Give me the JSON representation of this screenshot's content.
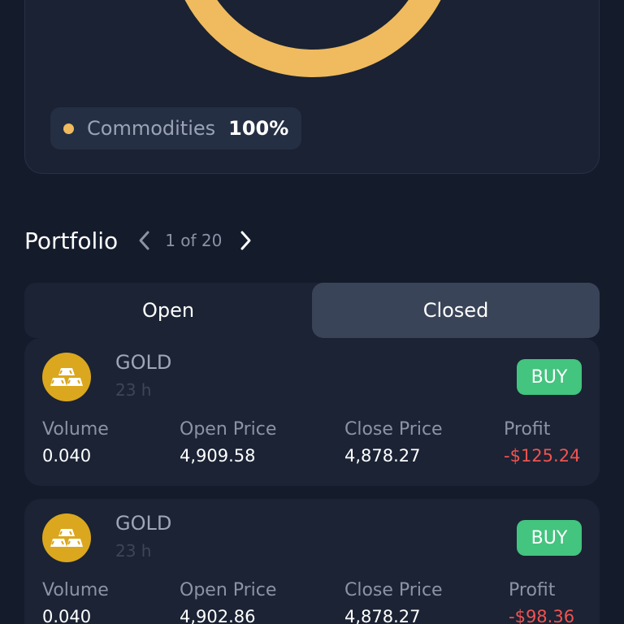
{
  "allocation": {
    "accent_color": "#efbb5e",
    "legend": [
      {
        "name": "Commodities",
        "percent": "100%",
        "color": "#efbb5e"
      }
    ]
  },
  "portfolio": {
    "title": "Portfolio",
    "pager": "1 of 20",
    "prev_icon": "chevron-left-icon",
    "next_icon": "chevron-right-icon"
  },
  "tabs": [
    {
      "label": "Open",
      "active": false
    },
    {
      "label": "Closed",
      "active": true
    }
  ],
  "columns": {
    "volume": "Volume",
    "open_price": "Open Price",
    "close_price": "Close Price",
    "profit": "Profit"
  },
  "positions": [
    {
      "symbol": "GOLD",
      "age": "23 h",
      "side": "BUY",
      "icon": "gold-bars-icon",
      "volume": "0.040",
      "open_price": "4,909.58",
      "close_price": "4,878.27",
      "profit": "-$125.24"
    },
    {
      "symbol": "GOLD",
      "age": "23 h",
      "side": "BUY",
      "icon": "gold-bars-icon",
      "volume": "0.040",
      "open_price": "4,902.86",
      "close_price": "4,878.27",
      "profit": "-$98.36"
    }
  ],
  "colors": {
    "background": "#141b2b",
    "card": "#1b2334",
    "buy_badge": "#43c47f",
    "loss": "#ef5350",
    "gold_coin": "#dba71e"
  }
}
